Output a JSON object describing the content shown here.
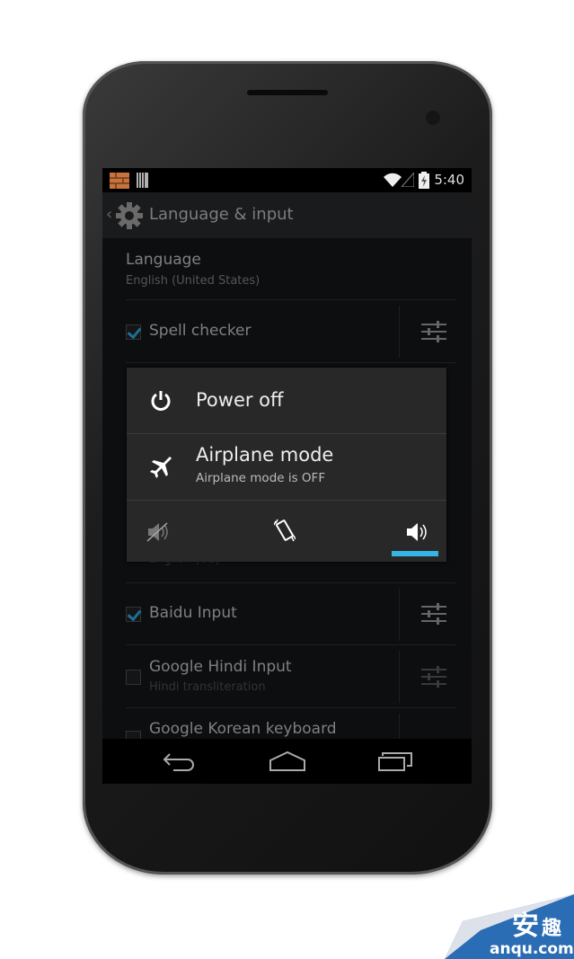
{
  "status_bar": {
    "time": "5:40",
    "icons": [
      "blocks-notification-icon",
      "barcode-notification-icon",
      "wifi-icon",
      "signal-icon",
      "battery-charging-icon"
    ]
  },
  "action_bar": {
    "title": "Language & input",
    "icon": "settings-gear-icon"
  },
  "list": [
    {
      "title": "Language",
      "subtitle": "English (United States)"
    },
    {
      "title": "Spell checker",
      "checked": true
    },
    {
      "subtitle": "English (US)"
    },
    {
      "title": "Baidu Input",
      "checked": true
    },
    {
      "title": "Google Hindi Input",
      "subtitle": "Hindi transliteration",
      "checked": false
    },
    {
      "title": "Google Korean keyboard",
      "checked": false
    }
  ],
  "dialog": {
    "power_off": "Power off",
    "airplane_title": "Airplane mode",
    "airplane_status": "Airplane mode is OFF",
    "ringer_modes": [
      "silent",
      "vibrate",
      "sound"
    ],
    "selected_mode": "sound",
    "accent_color": "#33b5e5"
  },
  "watermark": {
    "text": "安趣",
    "site": "anqu.com"
  }
}
